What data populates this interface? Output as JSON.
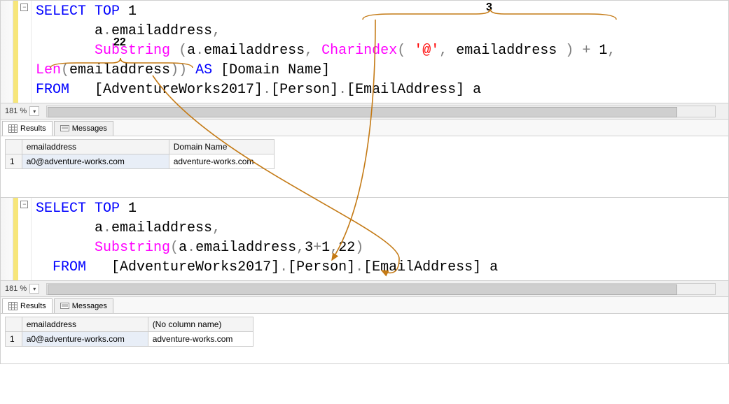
{
  "top": {
    "code_tokens": [
      [
        [
          "kw-blue",
          "SELECT"
        ],
        [
          null,
          " "
        ],
        [
          "kw-blue",
          "TOP"
        ],
        [
          null,
          " 1"
        ]
      ],
      [
        [
          null,
          "       a"
        ],
        [
          "kw-gray",
          "."
        ],
        [
          null,
          "emailaddress"
        ],
        [
          "kw-gray",
          ","
        ]
      ],
      [
        [
          null,
          "       "
        ],
        [
          "kw-pink",
          "Substring"
        ],
        [
          null,
          " "
        ],
        [
          "kw-gray",
          "("
        ],
        [
          null,
          "a"
        ],
        [
          "kw-gray",
          "."
        ],
        [
          null,
          "emailaddress"
        ],
        [
          "kw-gray",
          ","
        ],
        [
          null,
          " "
        ],
        [
          "kw-pink",
          "Charindex"
        ],
        [
          "kw-gray",
          "("
        ],
        [
          null,
          " "
        ],
        [
          "kw-red",
          "'@'"
        ],
        [
          "kw-gray",
          ","
        ],
        [
          null,
          " emailaddress "
        ],
        [
          "kw-gray",
          ")"
        ],
        [
          null,
          " "
        ],
        [
          "kw-gray",
          "+"
        ],
        [
          null,
          " 1"
        ],
        [
          "kw-gray",
          ","
        ]
      ],
      [
        [
          "kw-pink",
          "Len"
        ],
        [
          "kw-gray",
          "("
        ],
        [
          null,
          "emailaddress"
        ],
        [
          "kw-gray",
          ")) "
        ],
        [
          "kw-blue",
          "AS"
        ],
        [
          null,
          " [Domain Name]"
        ]
      ],
      [
        [
          "kw-blue",
          "FROM"
        ],
        [
          null,
          "   [AdventureWorks2017]"
        ],
        [
          "kw-gray",
          "."
        ],
        [
          null,
          "[Person]"
        ],
        [
          "kw-gray",
          "."
        ],
        [
          null,
          "[EmailAddress] a"
        ]
      ]
    ],
    "zoom": "181 %",
    "tabs": {
      "results": "Results",
      "messages": "Messages"
    },
    "grid": {
      "headers": [
        "emailaddress",
        "Domain Name"
      ],
      "rownum": "1",
      "row": [
        "a0@adventure-works.com",
        "adventure-works.com"
      ]
    }
  },
  "bottom": {
    "code_tokens": [
      [
        [
          "kw-blue",
          "SELECT"
        ],
        [
          null,
          " "
        ],
        [
          "kw-blue",
          "TOP"
        ],
        [
          null,
          " 1"
        ]
      ],
      [
        [
          null,
          "       a"
        ],
        [
          "kw-gray",
          "."
        ],
        [
          null,
          "emailaddress"
        ],
        [
          "kw-gray",
          ","
        ]
      ],
      [
        [
          null,
          "       "
        ],
        [
          "kw-pink",
          "Substring"
        ],
        [
          "kw-gray",
          "("
        ],
        [
          null,
          "a"
        ],
        [
          "kw-gray",
          "."
        ],
        [
          null,
          "emailaddress"
        ],
        [
          "kw-gray",
          ","
        ],
        [
          null,
          "3"
        ],
        [
          "kw-gray",
          "+"
        ],
        [
          null,
          "1"
        ],
        [
          "kw-gray",
          ","
        ],
        [
          null,
          "22"
        ],
        [
          "kw-gray",
          ")"
        ]
      ],
      [
        [
          null,
          "  "
        ],
        [
          "kw-blue",
          "FROM"
        ],
        [
          null,
          "   [AdventureWorks2017]"
        ],
        [
          "kw-gray",
          "."
        ],
        [
          null,
          "[Person]"
        ],
        [
          "kw-gray",
          "."
        ],
        [
          null,
          "[EmailAddress] a"
        ]
      ]
    ],
    "zoom": "181 %",
    "tabs": {
      "results": "Results",
      "messages": "Messages"
    },
    "grid": {
      "headers": [
        "emailaddress",
        "(No column name)"
      ],
      "rownum": "1",
      "row": [
        "a0@adventure-works.com",
        "adventure-works.com"
      ]
    }
  },
  "annotations": {
    "top_right": "3",
    "top_left": "22"
  }
}
